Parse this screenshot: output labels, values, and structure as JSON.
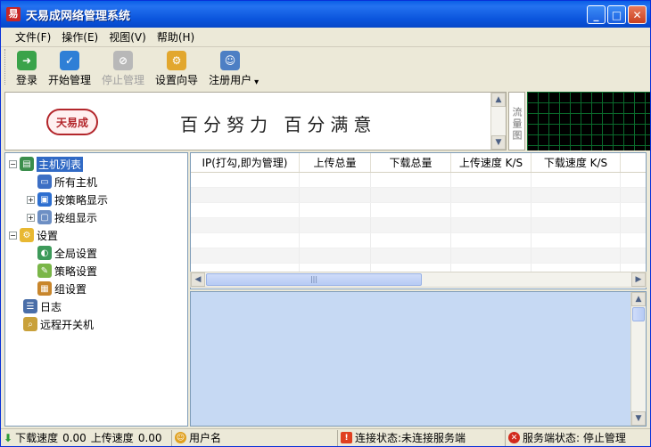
{
  "window": {
    "title": "天易成网络管理系统",
    "app_icon_glyph": "易",
    "controls": {
      "minimize": "_",
      "maximize": "□",
      "close": "✕"
    }
  },
  "menu": [
    "文件(F)",
    "操作(E)",
    "视图(V)",
    "帮助(H)"
  ],
  "toolbar": [
    {
      "label": "登录",
      "icon": "login-icon",
      "color": "#3aa34a",
      "enabled": true
    },
    {
      "label": "开始管理",
      "icon": "start-check-icon",
      "color": "#2f7fd6",
      "enabled": true
    },
    {
      "label": "停止管理",
      "icon": "stop-icon",
      "color": "#b8b8b8",
      "enabled": false
    },
    {
      "label": "设置向导",
      "icon": "wizard-icon",
      "color": "#e2a72e",
      "enabled": true
    },
    {
      "label": "注册用户",
      "icon": "user-register-icon",
      "color": "#4d7fc4",
      "enabled": true
    }
  ],
  "toolbar_dropdown": "▾",
  "banner": {
    "logo_text": "天易成",
    "slogan": "百分努力 百分满意"
  },
  "flow_label": "流量图",
  "tree": {
    "nodes": [
      {
        "label": "主机列表",
        "icon": "host-list-icon",
        "expander": "−",
        "selected": true
      },
      {
        "label": "所有主机",
        "icon": "all-hosts-icon"
      },
      {
        "label": "按策略显示",
        "icon": "policy-display-icon",
        "expander": "+"
      },
      {
        "label": "按组显示",
        "icon": "group-display-icon",
        "expander": "+"
      },
      {
        "label": "设置",
        "icon": "settings-folder-icon",
        "expander": "−"
      },
      {
        "label": "全局设置",
        "icon": "global-settings-icon"
      },
      {
        "label": "策略设置",
        "icon": "policy-settings-icon"
      },
      {
        "label": "组设置",
        "icon": "group-settings-icon"
      },
      {
        "label": "日志",
        "icon": "log-icon"
      },
      {
        "label": "远程开关机",
        "icon": "remote-power-icon"
      }
    ]
  },
  "table": {
    "columns": [
      "IP(打勾,即为管理)",
      "上传总量",
      "下载总量",
      "上传速度 K/S",
      "下载速度 K/S"
    ]
  },
  "status": {
    "download_label": "下载速度",
    "download_value": "0.00",
    "upload_label": "上传速度",
    "upload_value": "0.00",
    "user_label": "用户名",
    "connection": "连接状态:未连接服务端",
    "server": "服务端状态: 停止管理"
  },
  "colors": {
    "titlebar": "#0a54dc",
    "selection": "#316ac5",
    "log_pane": "#c6d9f3",
    "graph_bg": "#000000",
    "graph_grid": "#0a6b2c"
  }
}
